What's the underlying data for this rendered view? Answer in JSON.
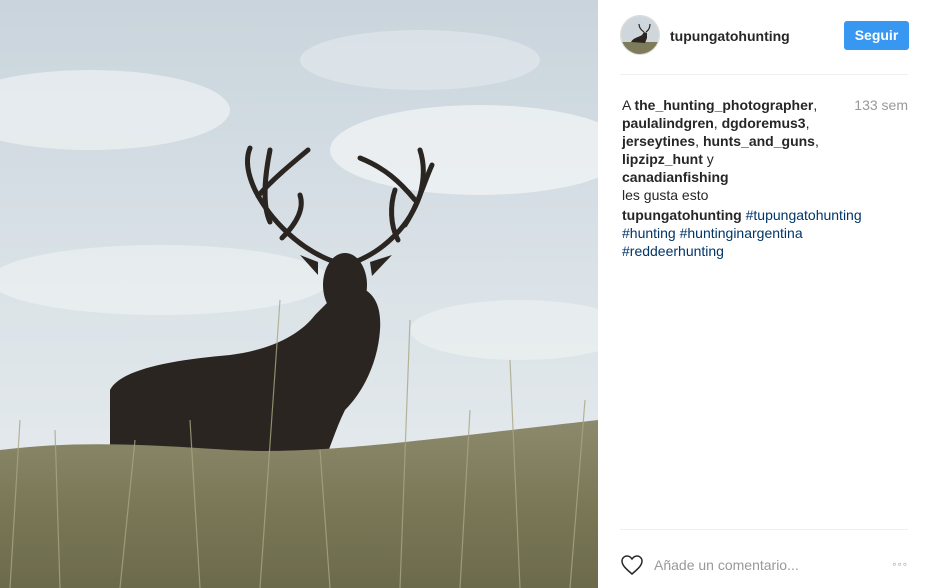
{
  "post": {
    "username": "tupungatohunting",
    "follow_label": "Seguir",
    "time_ago": "133 sem",
    "likes": {
      "prefix": "A ",
      "users": [
        "the_hunting_photographer",
        "paulalindgren",
        "dgdoremus3",
        "jerseytines",
        "hunts_and_guns",
        "lipzipz_hunt",
        "canadianfishing"
      ],
      "separator": ", ",
      "and_word": " y ",
      "suffix": "les gusta esto"
    },
    "caption": {
      "author": "tupungatohunting",
      "hashtags": [
        "#tupungatohunting",
        "#hunting",
        "#huntinginargentina",
        "#reddeerhunting"
      ]
    },
    "comment_placeholder": "Añade un comentario...",
    "more_label": "◦◦◦"
  },
  "icons": {
    "avatar": "deer-avatar",
    "like": "heart-icon",
    "more": "more-options-icon"
  },
  "colors": {
    "follow_button": "#3897f0",
    "hashtag": "#003569",
    "muted": "#999999"
  }
}
